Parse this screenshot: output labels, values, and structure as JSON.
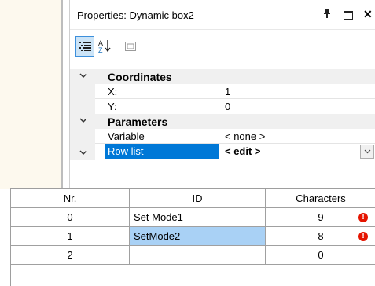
{
  "panel": {
    "title": "Properties: Dynamic box2",
    "pin_glyph": "ꟷ",
    "close_glyph": "✕"
  },
  "toolbar": {
    "categorized_icon": "categorized-view-icon",
    "alphabetical_icon": "sort-az-icon",
    "pages_icon": "property-pages-icon"
  },
  "grid": {
    "categories": [
      {
        "name": "Coordinates",
        "props": [
          {
            "name": "X:",
            "value": "1"
          },
          {
            "name": "Y:",
            "value": "0"
          }
        ]
      },
      {
        "name": "Parameters",
        "props": [
          {
            "name": "Variable",
            "value": "< none >"
          },
          {
            "name": "Row list",
            "value": "< edit >"
          }
        ]
      }
    ]
  },
  "table": {
    "columns": [
      "Nr.",
      "ID",
      "Characters"
    ],
    "rows": [
      {
        "nr": "0",
        "id": "Set Mode1",
        "chars": "9",
        "error": true
      },
      {
        "nr": "1",
        "id": "SetMode2",
        "chars": "8",
        "error": true
      },
      {
        "nr": "2",
        "id": "",
        "chars": "0",
        "error": false
      }
    ],
    "error_glyph": "!"
  },
  "colors": {
    "selection": "#0078d7",
    "cell_selection": "#a9d1f5",
    "error": "#e51400"
  }
}
